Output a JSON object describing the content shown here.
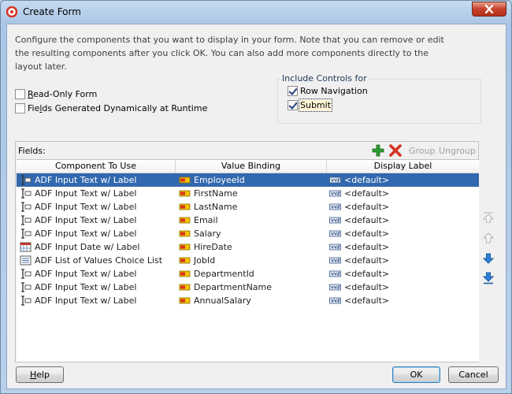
{
  "window": {
    "title": "Create Form"
  },
  "description": "Configure the components that you want to display in your form. Note that you can remove or edit the resulting components after you click OK. You can also add more components directly to the layout later.",
  "options": {
    "read_only_pre": "R",
    "read_only_post": "ead-Only Form",
    "read_only_checked": false,
    "dynamic_pre": "Fie",
    "dynamic_ul": "l",
    "dynamic_post": "ds Generated Dynamically at Runtime",
    "dynamic_checked": false
  },
  "include_controls": {
    "legend": "Include Controls for",
    "row_navigation": "Row Navigation",
    "row_navigation_checked": true,
    "submit": "Submit",
    "submit_checked": true
  },
  "fields": {
    "label": "Fields:",
    "toolbar": {
      "add_icon": "plus-icon",
      "remove_icon": "x-icon",
      "group": "Group",
      "ungroup": "Ungroup"
    },
    "columns": [
      "Component To Use",
      "Value Binding",
      "Display Label"
    ],
    "rows": [
      {
        "component": "ADF Input Text w/ Label",
        "binding": "EmployeeId",
        "label": "<default>",
        "icon": "input-text-icon",
        "selected": true
      },
      {
        "component": "ADF Input Text w/ Label",
        "binding": "FirstName",
        "label": "<default>",
        "icon": "input-text-icon",
        "selected": false
      },
      {
        "component": "ADF Input Text w/ Label",
        "binding": "LastName",
        "label": "<default>",
        "icon": "input-text-icon",
        "selected": false
      },
      {
        "component": "ADF Input Text w/ Label",
        "binding": "Email",
        "label": "<default>",
        "icon": "input-text-icon",
        "selected": false
      },
      {
        "component": "ADF Input Text w/ Label",
        "binding": "Salary",
        "label": "<default>",
        "icon": "input-text-icon",
        "selected": false
      },
      {
        "component": "ADF Input Date w/ Label",
        "binding": "HireDate",
        "label": "<default>",
        "icon": "input-date-icon",
        "selected": false
      },
      {
        "component": "ADF List of Values Choice List",
        "binding": "JobId",
        "label": "<default>",
        "icon": "list-of-values-icon",
        "selected": false
      },
      {
        "component": "ADF Input Text w/ Label",
        "binding": "DepartmentId",
        "label": "<default>",
        "icon": "input-text-icon",
        "selected": false
      },
      {
        "component": "ADF Input Text w/ Label",
        "binding": "DepartmentName",
        "label": "<default>",
        "icon": "input-text-icon",
        "selected": false
      },
      {
        "component": "ADF Input Text w/ Label",
        "binding": "AnnualSalary",
        "label": "<default>",
        "icon": "input-text-icon",
        "selected": false
      }
    ]
  },
  "side_buttons": [
    "move-to-top-icon",
    "move-up-icon",
    "move-down-icon",
    "move-to-bottom-icon"
  ],
  "buttons": {
    "help_ul": "H",
    "help_post": "elp",
    "ok": "OK",
    "cancel": "Cancel"
  },
  "colors": {
    "selection": "#3268ad",
    "add": "#2e9a2e",
    "remove": "#d8321e",
    "arrow": "#2f7fd8"
  }
}
